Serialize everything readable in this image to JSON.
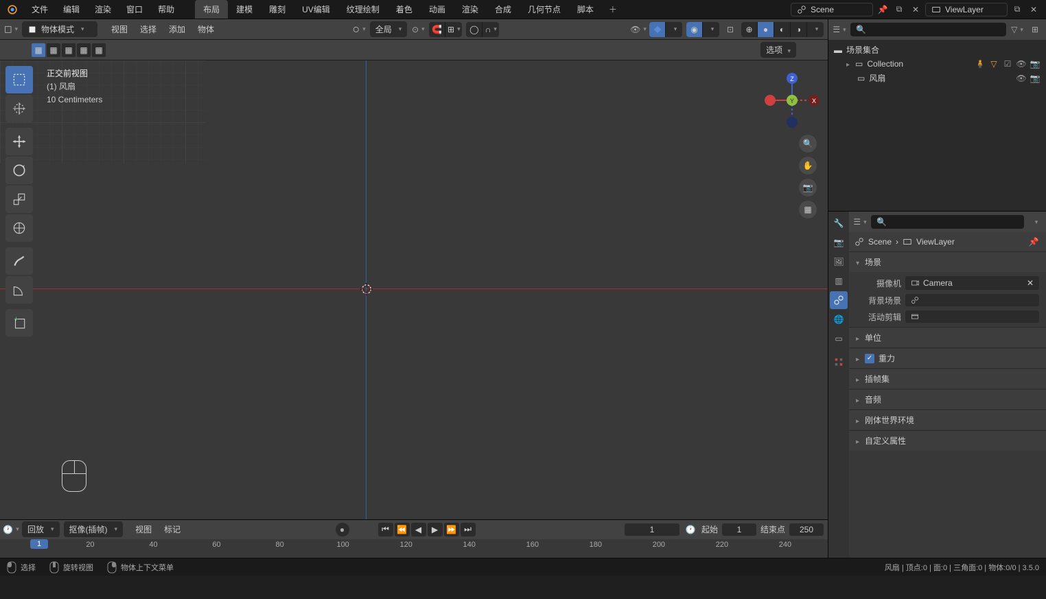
{
  "topmenu": [
    "文件",
    "编辑",
    "渲染",
    "窗口",
    "帮助"
  ],
  "workspaces": [
    "布局",
    "建模",
    "雕刻",
    "UV编辑",
    "纹理绘制",
    "着色",
    "动画",
    "渲染",
    "合成",
    "几何节点",
    "脚本"
  ],
  "active_workspace": "布局",
  "scene_name": "Scene",
  "viewlayer_name": "ViewLayer",
  "viewport": {
    "mode": "物体模式",
    "menus": [
      "视图",
      "选择",
      "添加",
      "物体"
    ],
    "orientation": "全局",
    "options_label": "选项",
    "info_l1": "正交前视图",
    "info_l2": "(1) 风扇",
    "info_l3": "10 Centimeters"
  },
  "gizmo_axes": {
    "x": "X",
    "y": "Y",
    "z": "Z"
  },
  "timeline": {
    "playback": "回放",
    "keying": "抠像(插帧)",
    "menus": [
      "视图",
      "标记"
    ],
    "current": "1",
    "start_label": "起始",
    "start_value": "1",
    "end_label": "结束点",
    "end_value": "250",
    "ticks": [
      "20",
      "40",
      "60",
      "80",
      "100",
      "120",
      "140",
      "160",
      "180",
      "200",
      "220",
      "240"
    ]
  },
  "outliner": {
    "root": "场景集合",
    "collection": "Collection",
    "child": "风扇"
  },
  "properties": {
    "breadcrumb_scene": "Scene",
    "breadcrumb_layer": "ViewLayer",
    "panel_scene": "场景",
    "camera_label": "摄像机",
    "camera_value": "Camera",
    "bg_label": "背景场景",
    "clip_label": "活动剪辑",
    "panels": [
      "单位",
      "重力",
      "插帧集",
      "音频",
      "刚体世界环境",
      "自定义属性"
    ]
  },
  "status": {
    "select": "选择",
    "rotate": "旋转视图",
    "context": "物体上下文菜单",
    "stats": "风扇 | 顶点:0 | 面:0 | 三角面:0 | 物体:0/0 | 3.5.0"
  }
}
